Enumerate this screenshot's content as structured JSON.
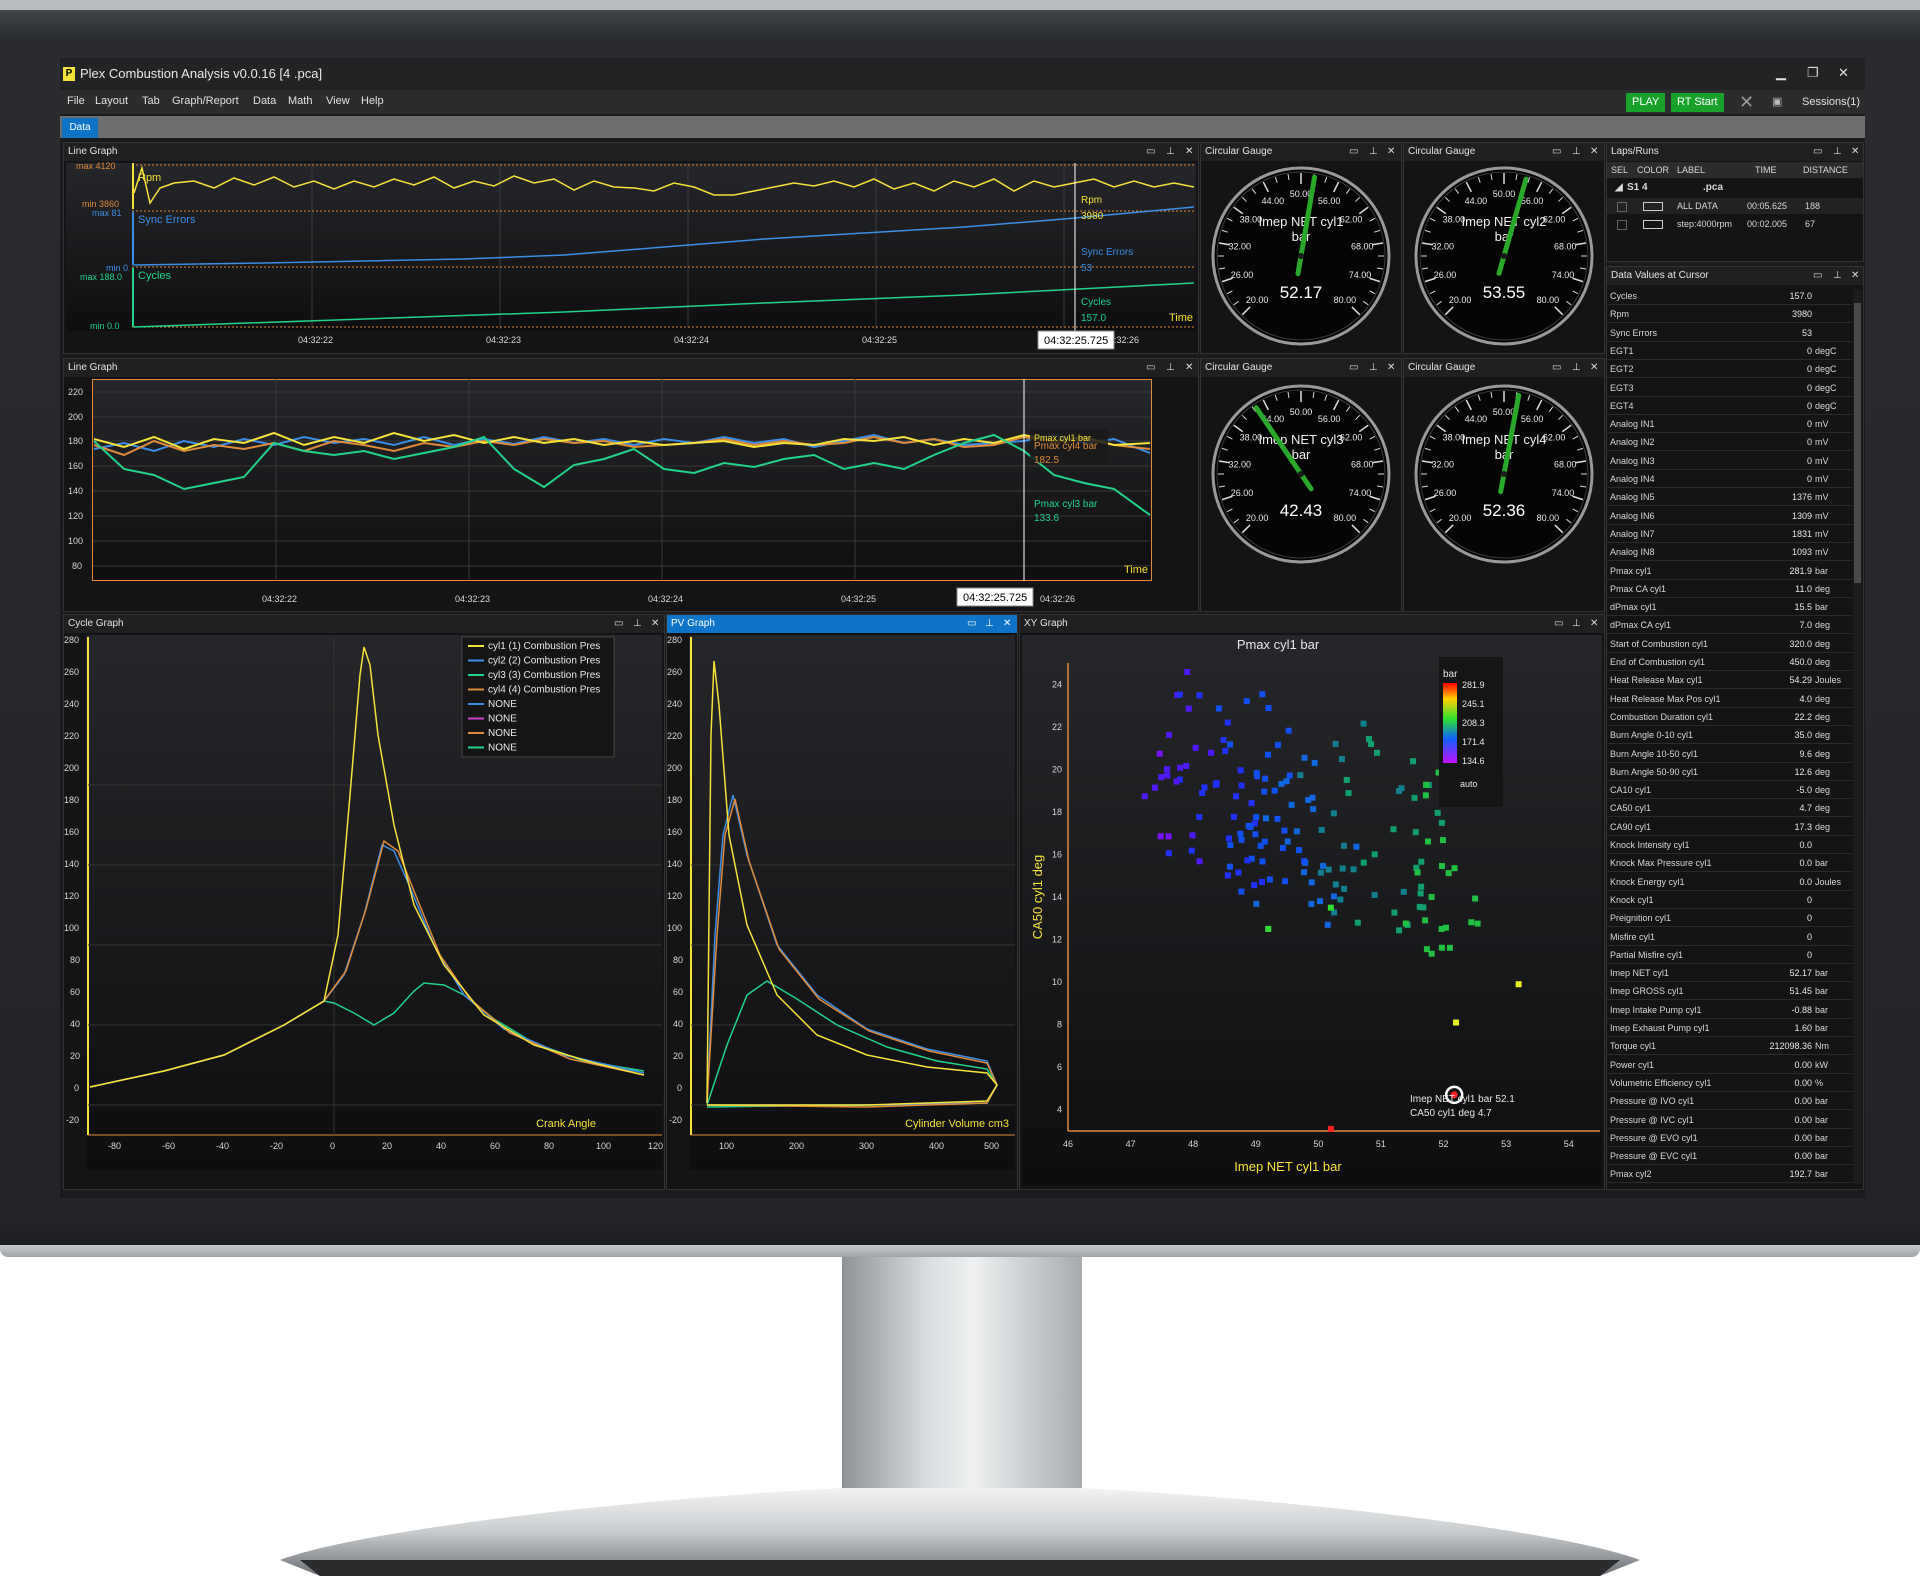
{
  "window": {
    "title": "Plex Combustion Analysis v0.0.16  [4           .pca]"
  },
  "menu": [
    "File",
    "Layout",
    "Tab",
    "Graph/Report",
    "Data",
    "Math",
    "View",
    "Help"
  ],
  "toolbar": {
    "play": "PLAY",
    "rt_start": "RT Start",
    "sessions": "Sessions(1)"
  },
  "tabs": {
    "data": "Data"
  },
  "line_graph_1": {
    "title": "Line Graph",
    "labels": {
      "max_rpm": "max 4120",
      "min_rpm": "min 3860",
      "max_sync": "max 81",
      "min_sync": "min 0",
      "max_cycles": "max 188.0",
      "min_cycles": "min 0.0"
    },
    "series_names": {
      "rpm": "Rpm",
      "sync": "Sync Errors",
      "cycles": "Cycles"
    },
    "cursor": {
      "rpm_name": "Rpm",
      "rpm_val": "3980",
      "sync_name": "Sync Errors",
      "sync_val": "53",
      "cycles_name": "Cycles",
      "cycles_val": "157.0"
    },
    "time_label": "Time",
    "x_ticks": [
      "04:32:22",
      "04:32:23",
      "04:32:24",
      "04:32:25",
      "04:32:26"
    ],
    "cursor_time": "04:32:25.725",
    "chart_data": {
      "type": "line",
      "x_ticks": [
        "04:32:22",
        "04:32:23",
        "04:32:24",
        "04:32:25",
        "04:32:26"
      ],
      "series": [
        {
          "name": "Rpm",
          "ylim": [
            3860,
            4120
          ],
          "cursor_value": 3980
        },
        {
          "name": "Sync Errors",
          "ylim": [
            0,
            81
          ],
          "cursor_value": 53
        },
        {
          "name": "Cycles",
          "ylim": [
            0,
            188
          ],
          "cursor_value": 157.0
        }
      ]
    }
  },
  "line_graph_2": {
    "title": "Line Graph",
    "y_ticks": [
      "220",
      "200",
      "180",
      "160",
      "140",
      "120",
      "100",
      "80"
    ],
    "x_ticks": [
      "04:32:22",
      "04:32:23",
      "04:32:24",
      "04:32:25",
      "04:32:26"
    ],
    "time_label": "Time",
    "cursor_time": "04:32:25.725",
    "cursor_labels": {
      "c1": "Pmax cyl1 bar",
      "c4_name": "Pmax cyl4 bar",
      "c4_val": "182.5",
      "c3_name": "Pmax cyl3 bar",
      "c3_val": "133.6"
    },
    "colors": {
      "cyl1": "#f5e23a",
      "cyl2": "#3a8ee8",
      "cyl3": "#21d48a",
      "cyl4": "#e08a3a"
    }
  },
  "gauges": [
    {
      "title": "Circular Gauge",
      "label1": "Imep NET cyl1",
      "label2": "bar",
      "value": "52.17",
      "needle": 52.17
    },
    {
      "title": "Circular Gauge",
      "label1": "Imep NET cyl2",
      "label2": "bar",
      "value": "53.55",
      "needle": 53.55
    },
    {
      "title": "Circular Gauge",
      "label1": "Imep NET cyl3",
      "label2": "bar",
      "value": "42.43",
      "needle": 42.43
    },
    {
      "title": "Circular Gauge",
      "label1": "Imep NET cyl4",
      "label2": "bar",
      "value": "52.36",
      "needle": 52.36
    }
  ],
  "gauge_ticks": [
    "20.00",
    "26.00",
    "32.00",
    "38.00",
    "44.00",
    "50.00",
    "56.00",
    "62.00",
    "68.00",
    "74.00",
    "80.00"
  ],
  "laps": {
    "title": "Laps/Runs",
    "headers": [
      "SEL",
      "COLOR",
      "LABEL",
      "TIME",
      "DISTANCE"
    ],
    "session": "S1  4",
    "session_file": ".pca",
    "rows": [
      {
        "label": "ALL DATA",
        "time": "00:05.625",
        "distance": "188"
      },
      {
        "label": "step:4000rpm",
        "time": "00:02.005",
        "distance": "67"
      }
    ]
  },
  "data_values": {
    "title": "Data Values at Cursor",
    "rows": [
      [
        "Cycles",
        "157.0",
        ""
      ],
      [
        "Rpm",
        "3980",
        ""
      ],
      [
        "Sync Errors",
        "53",
        ""
      ],
      [
        "EGT1",
        "0",
        "degC"
      ],
      [
        "EGT2",
        "0",
        "degC"
      ],
      [
        "EGT3",
        "0",
        "degC"
      ],
      [
        "EGT4",
        "0",
        "degC"
      ],
      [
        "Analog IN1",
        "0",
        "mV"
      ],
      [
        "Analog IN2",
        "0",
        "mV"
      ],
      [
        "Analog IN3",
        "0",
        "mV"
      ],
      [
        "Analog IN4",
        "0",
        "mV"
      ],
      [
        "Analog IN5",
        "1376",
        "mV"
      ],
      [
        "Analog IN6",
        "1309",
        "mV"
      ],
      [
        "Analog IN7",
        "1831",
        "mV"
      ],
      [
        "Analog IN8",
        "1093",
        "mV"
      ],
      [
        "Pmax cyl1",
        "281.9",
        "bar"
      ],
      [
        "Pmax CA cyl1",
        "11.0",
        "deg"
      ],
      [
        "dPmax cyl1",
        "15.5",
        "bar"
      ],
      [
        "dPmax CA cyl1",
        "7.0",
        "deg"
      ],
      [
        "Start of Combustion cyl1",
        "320.0",
        "deg"
      ],
      [
        "End of Combustion cyl1",
        "450.0",
        "deg"
      ],
      [
        "Heat Release Max cyl1",
        "54.29",
        "Joules"
      ],
      [
        "Heat Release Max Pos cyl1",
        "4.0",
        "deg"
      ],
      [
        "Combustion Duration cyl1",
        "22.2",
        "deg"
      ],
      [
        "Burn Angle 0-10 cyl1",
        "35.0",
        "deg"
      ],
      [
        "Burn Angle 10-50 cyl1",
        "9.6",
        "deg"
      ],
      [
        "Burn Angle 50-90 cyl1",
        "12.6",
        "deg"
      ],
      [
        "CA10 cyl1",
        "-5.0",
        "deg"
      ],
      [
        "CA50 cyl1",
        "4.7",
        "deg"
      ],
      [
        "CA90 cyl1",
        "17.3",
        "deg"
      ],
      [
        "Knock Intensity cyl1",
        "0.0",
        ""
      ],
      [
        "Knock Max Pressure cyl1",
        "0.0",
        "bar"
      ],
      [
        "Knock Energy cyl1",
        "0.0",
        "Joules"
      ],
      [
        "Knock cyl1",
        "0",
        ""
      ],
      [
        "Preignition cyl1",
        "0",
        ""
      ],
      [
        "Misfire cyl1",
        "0",
        ""
      ],
      [
        "Partial Misfire cyl1",
        "0",
        ""
      ],
      [
        "Imep NET cyl1",
        "52.17",
        "bar"
      ],
      [
        "Imep GROSS cyl1",
        "51.45",
        "bar"
      ],
      [
        "Imep Intake Pump cyl1",
        "-0.88",
        "bar"
      ],
      [
        "Imep Exhaust Pump cyl1",
        "1.60",
        "bar"
      ],
      [
        "Torque cyl1",
        "212098.36",
        "Nm"
      ],
      [
        "Power cyl1",
        "0.00",
        "kW"
      ],
      [
        "Volumetric Efficiency cyl1",
        "0.00",
        "%"
      ],
      [
        "Pressure @ IVO cyl1",
        "0.00",
        "bar"
      ],
      [
        "Pressure @ IVC cyl1",
        "0.00",
        "bar"
      ],
      [
        "Pressure @ EVO cyl1",
        "0.00",
        "bar"
      ],
      [
        "Pressure @ EVC cyl1",
        "0.00",
        "bar"
      ],
      [
        "Pmax cyl2",
        "192.7",
        "bar"
      ]
    ]
  },
  "cycle_graph": {
    "title": "Cycle Graph",
    "legend": [
      "cyl1 (1) Combustion Pres",
      "cyl2 (2) Combustion Pres",
      "cyl3 (3) Combustion Pres",
      "cyl4 (4) Combustion Pres",
      "NONE",
      "NONE",
      "NONE",
      "NONE"
    ],
    "legend_colors": [
      "#f5e23a",
      "#3a8ee8",
      "#21d48a",
      "#e08a3a",
      "#3a8ee8",
      "#d040d0",
      "#e08a3a",
      "#21d48a"
    ],
    "xlabel": "Crank Angle",
    "y_ticks": [
      "280",
      "260",
      "240",
      "220",
      "200",
      "180",
      "160",
      "140",
      "120",
      "100",
      "80",
      "60",
      "40",
      "20",
      "0",
      "-20"
    ],
    "x_ticks": [
      "-80",
      "-60",
      "-40",
      "-20",
      "0",
      "20",
      "40",
      "60",
      "80",
      "100",
      "120"
    ]
  },
  "pv_graph": {
    "title": "PV Graph",
    "xlabel": "Cylinder Volume cm3",
    "y_ticks": [
      "280",
      "260",
      "240",
      "220",
      "200",
      "180",
      "160",
      "140",
      "120",
      "100",
      "80",
      "60",
      "40",
      "20",
      "0",
      "-20"
    ],
    "x_ticks": [
      "100",
      "200",
      "300",
      "400",
      "500"
    ]
  },
  "xy_graph": {
    "title": "XY Graph",
    "chart_title": "Pmax cyl1 bar",
    "xlabel": "Imep NET cyl1 bar",
    "ylabel": "CA50 cyl1 deg",
    "x_ticks": [
      "46",
      "47",
      "48",
      "49",
      "50",
      "51",
      "52",
      "53",
      "54"
    ],
    "y_ticks": [
      "24",
      "22",
      "20",
      "18",
      "16",
      "14",
      "12",
      "10",
      "8",
      "6",
      "4"
    ],
    "colorbar": {
      "title": "bar",
      "ticks": [
        "281.9",
        "245.1",
        "208.3",
        "171.4",
        "134.6"
      ],
      "mode": "auto"
    },
    "cursor_label1": "Imep NET cyl1 bar 52.1",
    "cursor_label2": "CA50 cyl1 deg 4.7",
    "chart_data": {
      "type": "scatter",
      "xlabel": "Imep NET cyl1 bar",
      "ylabel": "CA50 cyl1 deg",
      "xlim": [
        46,
        54.5
      ],
      "ylim": [
        3,
        25
      ],
      "color_range": [
        134.6,
        281.9
      ],
      "cursor_point": {
        "x": 52.17,
        "y": 4.7
      }
    }
  }
}
